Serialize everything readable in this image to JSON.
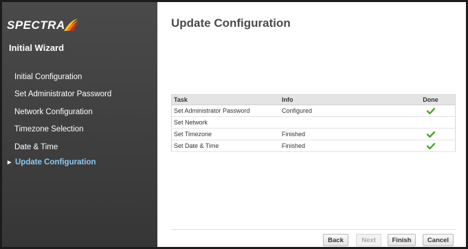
{
  "brand": {
    "logo_text": "SPECTRA",
    "logo_colors": [
      "#f6c025",
      "#e8771f",
      "#c9321c"
    ]
  },
  "sidebar": {
    "title": "Initial Wizard",
    "items": [
      {
        "label": "Initial Configuration",
        "active": false
      },
      {
        "label": "Set Administrator Password",
        "active": false
      },
      {
        "label": "Network Configuration",
        "active": false
      },
      {
        "label": "Timezone Selection",
        "active": false
      },
      {
        "label": "Date & Time",
        "active": false
      },
      {
        "label": "Update Configuration",
        "active": true
      }
    ],
    "active_arrow": "▶",
    "active_color": "#8ec8f0"
  },
  "main": {
    "title": "Update Configuration",
    "table": {
      "headers": {
        "task": "Task",
        "info": "Info",
        "done": "Done"
      },
      "rows": [
        {
          "task": "Set Administrator Password",
          "info": "Configured",
          "done": true
        },
        {
          "task": "Set Network",
          "info": "",
          "done": false
        },
        {
          "task": "Set Timezone",
          "info": "Finished",
          "done": true
        },
        {
          "task": "Set Date & Time",
          "info": "Finished",
          "done": true
        }
      ],
      "done_icon": "checkmark-icon",
      "done_color": "#4ca62e"
    }
  },
  "buttons": {
    "back": "Back",
    "next": "Next",
    "finish": "Finish",
    "cancel": "Cancel"
  }
}
